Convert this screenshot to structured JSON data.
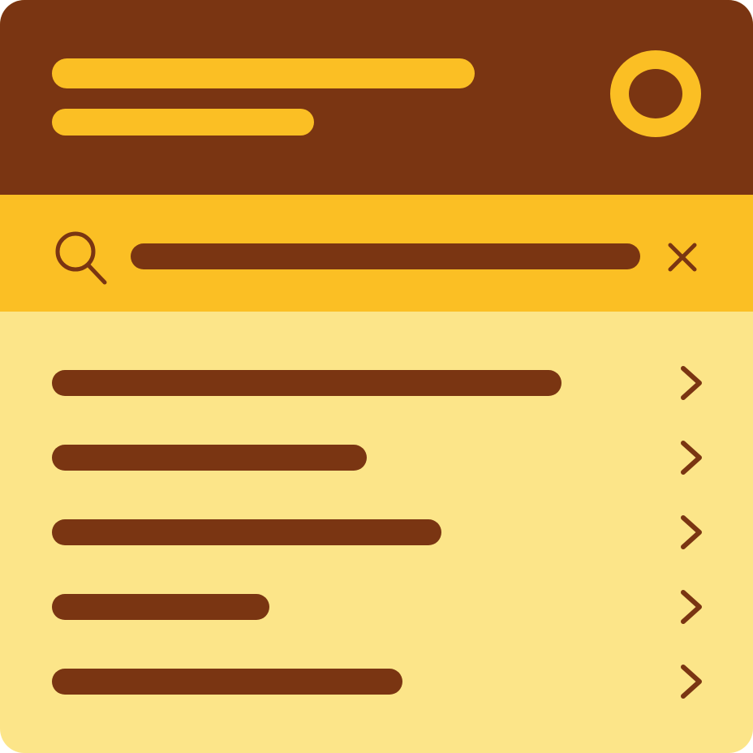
{
  "colors": {
    "header_bg": "#7A3512",
    "accent": "#FBBF24",
    "list_bg": "#FCE589",
    "ink": "#7A3512"
  },
  "icons": {
    "profile": "avatar-ring-icon",
    "search": "search-icon",
    "clear": "close-icon",
    "row_action": "chevron-right-icon"
  },
  "header": {
    "title": "",
    "subtitle": ""
  },
  "search": {
    "value": ""
  },
  "list": {
    "items": [
      {
        "label": ""
      },
      {
        "label": ""
      },
      {
        "label": ""
      },
      {
        "label": ""
      },
      {
        "label": ""
      }
    ]
  }
}
